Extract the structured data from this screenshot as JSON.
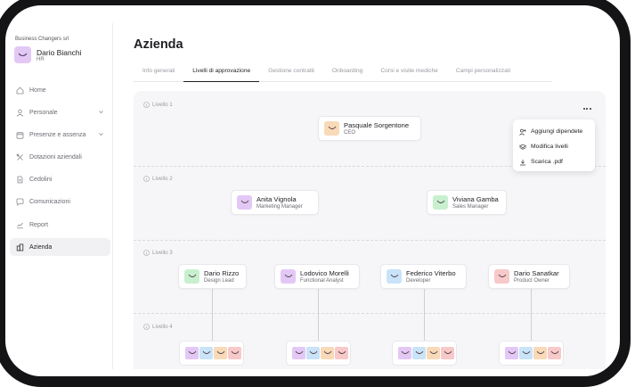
{
  "sidebar": {
    "company": "Business Changers srl",
    "user": {
      "name": "Dario Bianchi",
      "role": "HR"
    },
    "items": [
      {
        "label": "Home",
        "icon": "home-icon"
      },
      {
        "label": "Personale",
        "icon": "person-icon",
        "expandable": true
      },
      {
        "label": "Presenze e assenza",
        "icon": "calendar-icon",
        "expandable": true
      },
      {
        "label": "Dotazioni aziendali",
        "icon": "tools-icon"
      },
      {
        "label": "Cedolini",
        "icon": "document-icon"
      },
      {
        "label": "Comunicazioni",
        "icon": "chat-icon"
      },
      {
        "label": "Report",
        "icon": "chart-icon"
      },
      {
        "label": "Azienda",
        "icon": "building-icon",
        "active": true
      }
    ]
  },
  "page": {
    "title": "Azienda"
  },
  "tabs": [
    "Info generali",
    "Livelli di approvazione",
    "Gestione contratti",
    "Onboarding",
    "Corsi e visite mediche",
    "Campi personalizzati"
  ],
  "active_tab": "Livelli di approvazione",
  "levels": [
    "Livello 1",
    "Livello 2",
    "Livello 3",
    "Livello 4"
  ],
  "people": {
    "l1": [
      {
        "name": "Pasquale Sorgentone",
        "role": "CEO",
        "color": "#f8d9b8"
      }
    ],
    "l2": [
      {
        "name": "Anita Vignola",
        "role": "Marketing Manager",
        "color": "#e3c8f6"
      },
      {
        "name": "Viviana Gamba",
        "role": "Sales Manager",
        "color": "#c8f0cf"
      }
    ],
    "l3": [
      {
        "name": "Dario Rizzo",
        "role": "Design Lead",
        "color": "#c8f0cf"
      },
      {
        "name": "Lodovico Morelli",
        "role": "Functional Analyst",
        "color": "#e3c8f6"
      },
      {
        "name": "Federico Viterbo",
        "role": "Developer",
        "color": "#c9e3f8"
      },
      {
        "name": "Dario Sanatkar",
        "role": "Product Owner",
        "color": "#f8c9c9"
      }
    ]
  },
  "group_avatar_colors": [
    "#e3c8f6",
    "#c9e3f8",
    "#f8d9b8",
    "#f8c9c9"
  ],
  "menu": {
    "items": [
      {
        "label": "Aggiungi dipendete",
        "icon": "add-user-icon"
      },
      {
        "label": "Modifica livelli",
        "icon": "layers-icon"
      },
      {
        "label": "Scarica .pdf",
        "icon": "download-icon"
      }
    ]
  }
}
